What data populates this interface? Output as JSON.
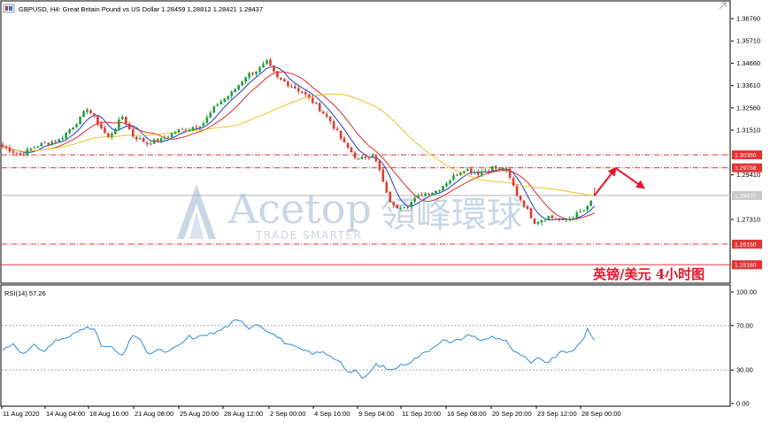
{
  "chart_title": "GBPUSD, H4:  Great Britain Pound vs US Dollar  1.28459 1.28812 1.28421 1.28437",
  "caption": "英镑/美元  4小时图",
  "watermark": {
    "brand": "Acetop",
    "brand_cn": "領峰環球",
    "tagline": "TRADE SMARTER"
  },
  "window_icons": {
    "left": "window-restore-icon",
    "right": "arrow-up-right-icon"
  },
  "colors": {
    "bull": "#1fa13b",
    "bear": "#e03a2e",
    "ma_fast": "#1f3fd1",
    "ma_mid": "#e02b2b",
    "ma_slow": "#f2c229",
    "rsi": "#2f8fd6",
    "level": "#e23333",
    "current": "#b5b5b5",
    "tag_bg": "#e23333",
    "arrow": "#e8132b"
  },
  "chart_data": [
    {
      "type": "candlestick",
      "title": "GBPUSD, H4:  Great Britain Pound vs US Dollar  1.28459 1.28812 1.28421 1.28437",
      "ylim": [
        1.247,
        1.372
      ],
      "y_ticks": [
        "1.36760",
        "1.35710",
        "1.34660",
        "1.33610",
        "1.32560",
        "1.31510",
        "1.29410",
        "1.27310"
      ],
      "x_ticks": [
        "11 Aug 2020",
        "14 Aug 04:00",
        "18 Aug 16:00",
        "21 Aug 08:00",
        "25 Aug 20:00",
        "28 Aug 12:00",
        "2 Sep 00:00",
        "4 Sep 16:00",
        "9 Sep 04:00",
        "11 Sep 20:00",
        "16 Sep 08:00",
        "20 Sep 20:00",
        "23 Sep 12:00",
        "28 Sep 00:00"
      ],
      "close_anchors": [
        [
          0,
          1.3075
        ],
        [
          5,
          1.3035
        ],
        [
          10,
          1.308
        ],
        [
          16,
          1.3105
        ],
        [
          22,
          1.3205
        ],
        [
          24,
          1.3255
        ],
        [
          27,
          1.3185
        ],
        [
          30,
          1.3115
        ],
        [
          34,
          1.3215
        ],
        [
          37,
          1.3125
        ],
        [
          41,
          1.309
        ],
        [
          45,
          1.3105
        ],
        [
          49,
          1.3145
        ],
        [
          53,
          1.316
        ],
        [
          57,
          1.3185
        ],
        [
          61,
          1.3275
        ],
        [
          65,
          1.3325
        ],
        [
          69,
          1.3405
        ],
        [
          73,
          1.344
        ],
        [
          75,
          1.347
        ],
        [
          78,
          1.3395
        ],
        [
          81,
          1.337
        ],
        [
          85,
          1.333
        ],
        [
          89,
          1.327
        ],
        [
          93,
          1.3195
        ],
        [
          97,
          1.3085
        ],
        [
          101,
          1.301
        ],
        [
          105,
          1.304
        ],
        [
          107,
          1.296
        ],
        [
          109,
          1.285
        ],
        [
          111,
          1.279
        ],
        [
          115,
          1.28
        ],
        [
          119,
          1.285
        ],
        [
          123,
          1.2865
        ],
        [
          127,
          1.292
        ],
        [
          131,
          1.297
        ],
        [
          135,
          1.295
        ],
        [
          139,
          1.2975
        ],
        [
          143,
          1.296
        ],
        [
          146,
          1.285
        ],
        [
          148,
          1.28
        ],
        [
          151,
          1.272
        ],
        [
          155,
          1.2745
        ],
        [
          159,
          1.272
        ],
        [
          163,
          1.2755
        ],
        [
          166,
          1.2785
        ],
        [
          168,
          1.2844
        ]
      ],
      "series": [
        {
          "name": "",
          "type": "moving-average",
          "color": "#1f3fd1",
          "period_bars": 6
        },
        {
          "name": "",
          "type": "moving-average",
          "color": "#e02b2b",
          "period_bars": 12
        },
        {
          "name": "",
          "type": "moving-average",
          "color": "#f2c229",
          "period_bars": 40
        }
      ],
      "levels": [
        {
          "value": 1.3035,
          "label": "1.30350",
          "style": "dash-dot"
        },
        {
          "value": 1.29738,
          "label": "1.29738",
          "style": "dash-dot"
        },
        {
          "value": 1.28437,
          "label": "1.28437",
          "style": "current"
        },
        {
          "value": 1.2615,
          "label": "1.26150",
          "style": "dash-dot"
        },
        {
          "value": 1.2518,
          "label": "1.25180",
          "style": "solid"
        }
      ],
      "forecast": [
        [
          168,
          1.2844
        ],
        [
          174,
          1.2972
        ],
        [
          182,
          1.288
        ]
      ],
      "grid": false
    },
    {
      "type": "line",
      "title": "RSI(14) 57.26",
      "ylim": [
        0,
        100
      ],
      "y_ticks": [
        "100.00",
        "70.00",
        "30.00",
        "0.00"
      ],
      "reference_levels": [
        70,
        30
      ],
      "anchors": [
        [
          0,
          48
        ],
        [
          3,
          54
        ],
        [
          6,
          44
        ],
        [
          9,
          52
        ],
        [
          12,
          47
        ],
        [
          15,
          57
        ],
        [
          18,
          58
        ],
        [
          21,
          64
        ],
        [
          24,
          70
        ],
        [
          26,
          66
        ],
        [
          28,
          52
        ],
        [
          31,
          50
        ],
        [
          34,
          42
        ],
        [
          37,
          62
        ],
        [
          39,
          58
        ],
        [
          41,
          44
        ],
        [
          44,
          48
        ],
        [
          47,
          46
        ],
        [
          50,
          52
        ],
        [
          53,
          60
        ],
        [
          55,
          58
        ],
        [
          57,
          62
        ],
        [
          60,
          63
        ],
        [
          63,
          68
        ],
        [
          66,
          74
        ],
        [
          68,
          73
        ],
        [
          70,
          68
        ],
        [
          72,
          72
        ],
        [
          74,
          68
        ],
        [
          77,
          62
        ],
        [
          80,
          55
        ],
        [
          83,
          50
        ],
        [
          86,
          47
        ],
        [
          88,
          44
        ],
        [
          90,
          47
        ],
        [
          93,
          42
        ],
        [
          96,
          38
        ],
        [
          98,
          28
        ],
        [
          100,
          30
        ],
        [
          102,
          22
        ],
        [
          104,
          27
        ],
        [
          106,
          35
        ],
        [
          108,
          33
        ],
        [
          110,
          30
        ],
        [
          113,
          34
        ],
        [
          116,
          38
        ],
        [
          119,
          44
        ],
        [
          122,
          50
        ],
        [
          125,
          58
        ],
        [
          127,
          54
        ],
        [
          130,
          58
        ],
        [
          133,
          62
        ],
        [
          136,
          56
        ],
        [
          139,
          60
        ],
        [
          141,
          58
        ],
        [
          143,
          57
        ],
        [
          145,
          46
        ],
        [
          147,
          44
        ],
        [
          150,
          36
        ],
        [
          152,
          40
        ],
        [
          155,
          37
        ],
        [
          158,
          45
        ],
        [
          161,
          47
        ],
        [
          163,
          50
        ],
        [
          165,
          58
        ],
        [
          166,
          67
        ],
        [
          168,
          57
        ]
      ],
      "last_value": "57.26"
    }
  ]
}
